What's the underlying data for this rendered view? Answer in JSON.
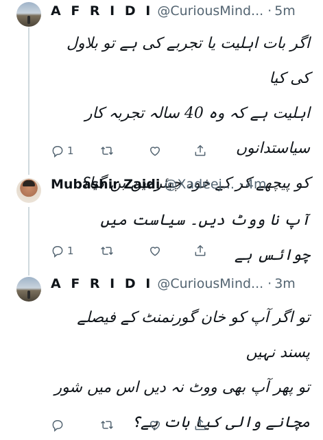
{
  "tweets": [
    {
      "name": "A F R I D I",
      "handle": "@CuriousMind...",
      "dot": "·",
      "time": "5m",
      "lines": [
        "اگر بات اہلیت یا تجربے کی ہے تو بلاول کی کیا",
        "اہلیت ہے کہ وہ 40 سالہ تجربہ کار سیاستدانوں",
        "کو پیچھے کر کے خود چیئرمین بن گیا؟"
      ],
      "reply_count": "1",
      "avatar": "road-avatar"
    },
    {
      "name": "Mubashir Zaidi",
      "handle": "@Xadeej...",
      "dot": "·",
      "time": "4m",
      "lines": [
        "آپ نا ووٹ دیں۔ سیاست میں چوائس ہے"
      ],
      "reply_count": "1",
      "avatar": "person-avatar"
    },
    {
      "name": "A F R I D I",
      "handle": "@CuriousMind...",
      "dot": "·",
      "time": "3m",
      "lines": [
        "تو اگر آپ کو خان گورنمنٹ کے فیصلے پسند نہیں",
        "تو پھر آپ بھی ووٹ نہ دیں اس میں شور",
        "مچانے والی کیا بات ہے؟"
      ],
      "reply_count": "",
      "avatar": "road-avatar"
    }
  ],
  "icons": [
    "reply-icon",
    "retweet-icon",
    "like-icon",
    "share-icon"
  ],
  "colors": {
    "text": "#0f1419",
    "secondary": "#536471",
    "thread_line": "#cfd9de"
  }
}
